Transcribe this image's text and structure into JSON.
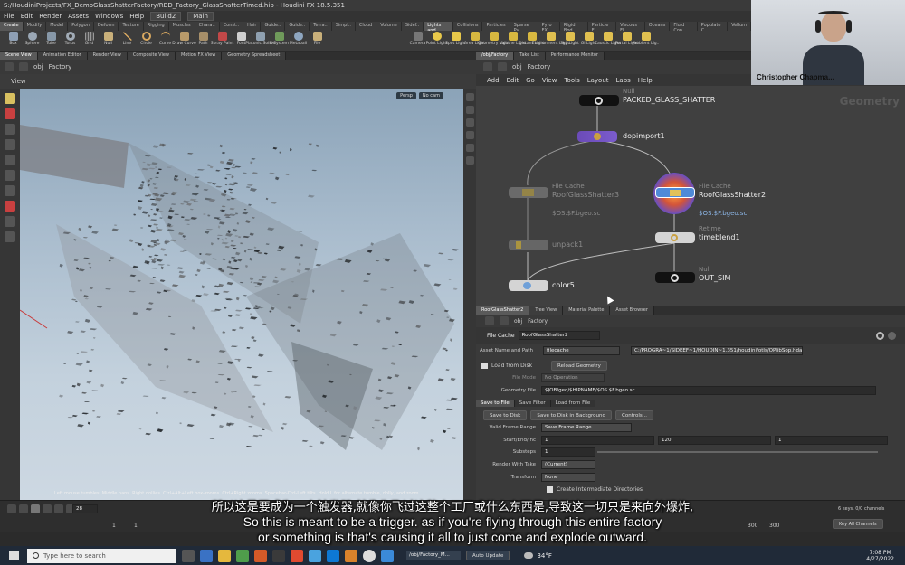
{
  "window": {
    "title": "S:/HoudiniProjects/FX_DemoGlassShatterFactory/RBD_Factory_GlassShatterTimed.hip - Houdini FX 18.5.351"
  },
  "menubar": {
    "items": [
      "File",
      "Edit",
      "Render",
      "Assets",
      "Windows",
      "Help"
    ],
    "build": "Build2",
    "desktop": "Main"
  },
  "shelf": {
    "tabs": [
      "Create",
      "Modify",
      "Model",
      "Polygon",
      "Deform",
      "Texture",
      "Rigging",
      "Muscles",
      "Chara..",
      "Const..",
      "Hair",
      "Guide..",
      "Guide..",
      "Terra..",
      "Simpl..",
      "Cloud",
      "Volume",
      "Sidef.."
    ],
    "right_tabs": [
      "Lights and..",
      "Collisions",
      "Particles",
      "Sparse Py..",
      "Pyro FX",
      "Rigid Bod..",
      "Particle Fl..",
      "Viscous Fl..",
      "Oceans",
      "Fluid Con..",
      "Populate C..",
      "Vellum"
    ],
    "tools": [
      "Box",
      "Sphere",
      "Tube",
      "Torus",
      "Grid",
      "Null",
      "Line",
      "Circle",
      "Curve",
      "Draw Curve",
      "Path",
      "Spray Paint",
      "Font",
      "Platonic Solids",
      "L-System",
      "Metaball",
      "File"
    ],
    "light_tools": [
      "Camera",
      "Point Light",
      "Spot Light",
      "Area Light",
      "Geometry Light",
      "Volume Light",
      "Distant Light",
      "Environment Light",
      "Sky Light",
      "GI Light",
      "Caustic Light",
      "Portal Light",
      "Ambient Lig.."
    ]
  },
  "left_pane": {
    "tabs": [
      "Scene View",
      "Animation Editor",
      "Render View",
      "Composite View",
      "Motion FX View",
      "Geometry Spreadsheet"
    ],
    "path_root": "obj",
    "path_node": "Factory",
    "view_label": "View",
    "persp": "Persp",
    "cam": "No cam",
    "status": "Left mouse tumbles. Middle pans. Right dollies. Ctrl+Alt+Left box-zooms. Ctrl+Right zooms. Spacebar-Ctrl-Left tilts. Hold L for alternate tumble, dolly, and zoom."
  },
  "network": {
    "tabs": [
      "/obj/Factory",
      "Take List",
      "Performance Monitor"
    ],
    "path_root": "obj",
    "path_node": "Factory",
    "menu": [
      "Add",
      "Edit",
      "Go",
      "View",
      "Tools",
      "Layout",
      "Labs",
      "Help"
    ],
    "context_label": "Geometry",
    "nodes": {
      "null_top": {
        "type": "Null",
        "name": "PACKED_GLASS_SHATTER"
      },
      "dopimport": {
        "name": "dopimport1"
      },
      "filecache_left": {
        "type": "File Cache",
        "name": "RoofGlassShatter3",
        "file": "$OS.$F.bgeo.sc"
      },
      "filecache_right": {
        "type": "File Cache",
        "name": "RoofGlassShatter2",
        "file": "$OS.$F.bgeo.sc"
      },
      "unpack": {
        "name": "unpack1"
      },
      "timeblend": {
        "type": "Retime",
        "name": "timeblend1"
      },
      "color": {
        "name": "color5"
      },
      "out": {
        "type": "Null",
        "name": "OUT_SIM"
      }
    }
  },
  "params": {
    "tabs": [
      "RoofGlassShatter2",
      "Tree View",
      "Material Palette",
      "Asset Browser"
    ],
    "path_root": "obj",
    "path_node": "Factory",
    "node_type": "File Cache",
    "node_name": "RoofGlassShatter2",
    "asset_label": "Asset Name and Path",
    "asset_name": "filecache",
    "asset_path": "C:/PROGRA~1/SIDEEF~1/HOUDIN~1.351/houdini/otls/OPlibSop.hda",
    "load_from_disk": "Load from Disk",
    "reload_geometry": "Reload Geometry",
    "file_mode_label": "File Mode",
    "file_mode": "No Operation",
    "geometry_file_label": "Geometry File",
    "geometry_file": "$JOB/geo/$HIPNAME/$OS.$F.bgeo.sc",
    "sub_tabs": [
      "Save to File",
      "Save Filter",
      "Load from File"
    ],
    "save_to_disk": "Save to Disk",
    "save_bg": "Save to Disk in Background",
    "controls": "Controls...",
    "valid_range_label": "Valid Frame Range",
    "valid_range": "Save Frame Range",
    "start_end_label": "Start/End/Inc",
    "start": "1",
    "end": "120",
    "inc": "1",
    "substeps_label": "Substeps",
    "substeps": "1",
    "render_take_label": "Render With Take",
    "render_take": "(Current)",
    "transform_label": "Transform",
    "transform": "None",
    "create_dirs": "Create Intermediate Directories"
  },
  "timeline": {
    "frame": "28",
    "start": "1",
    "start2": "1",
    "end": "300",
    "end2": "300",
    "keys": "6 keys, 0/0 channels",
    "key_all": "Key All Channels",
    "auto_update": "Auto Update",
    "path": "/obj/Factory_M..."
  },
  "webcam": {
    "name": "Christopher Chapma..."
  },
  "subtitles": {
    "cn": "所以这是要成为一个触发器,就像你飞过这整个工厂或什么东西是,导致这一切只是来向外爆炸,",
    "en1": "So this is meant to be a trigger. as if you're flying through this entire factory",
    "en2": "or something is that's causing it all to just come and explode outward."
  },
  "taskbar": {
    "search_placeholder": "Type here to search",
    "weather": "34°F",
    "time": "7:08 PM",
    "date": "4/27/2022"
  }
}
